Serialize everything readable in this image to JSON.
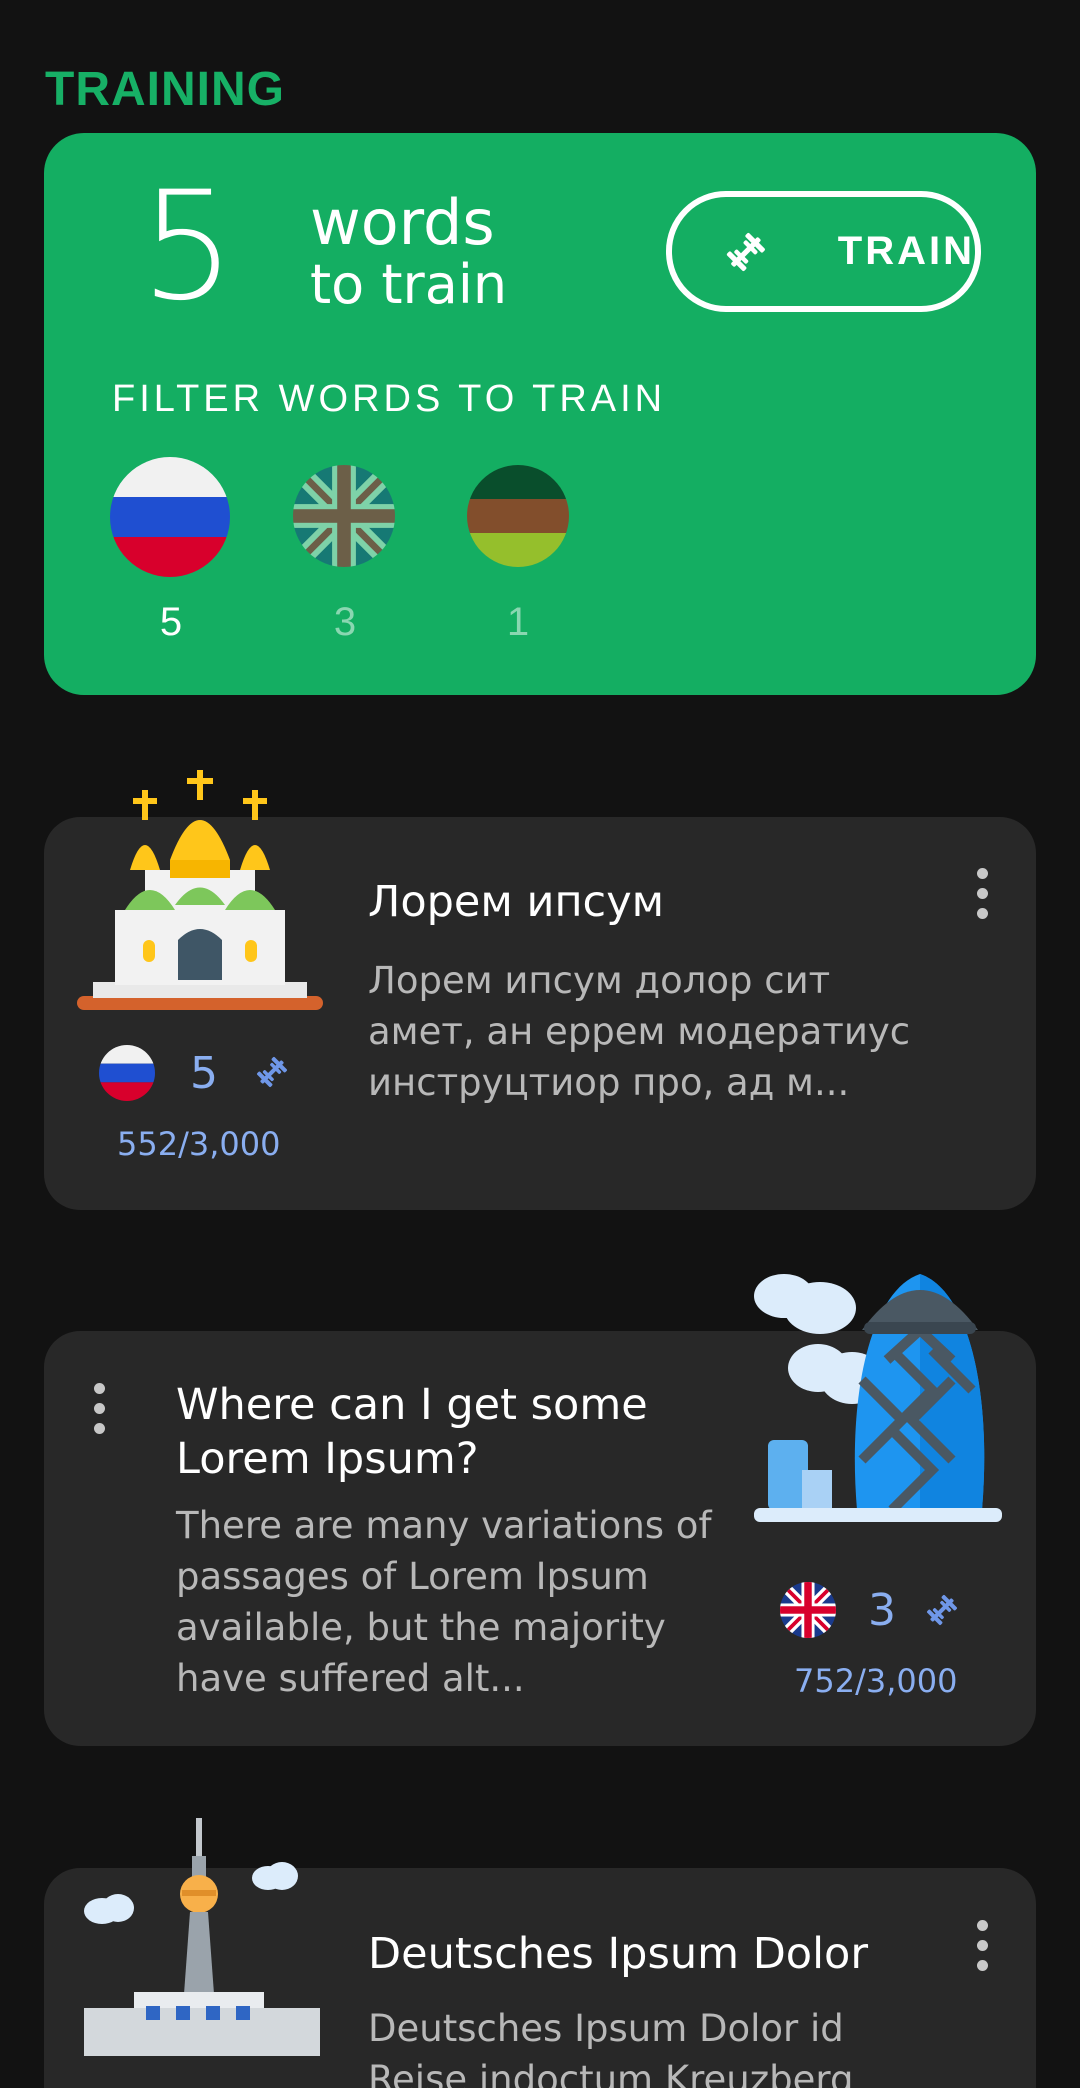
{
  "section": {
    "title": "TRAINING"
  },
  "training_card": {
    "count": "5",
    "words_label": "words",
    "to_train_label": "to train",
    "train_button": "TRAIN",
    "filter_label": "FILTER WORDS TO TRAIN",
    "filters": [
      {
        "flag": "russia-flag",
        "count": "5",
        "selected": true
      },
      {
        "flag": "uk-flag",
        "count": "3",
        "selected": false
      },
      {
        "flag": "germany-flag",
        "count": "1",
        "selected": false
      }
    ]
  },
  "lessons": [
    {
      "illustration": "church-illustration",
      "title": "Лорем ипсум",
      "description": "Лорем ипсум долор сит амет, ан еррем модератиус инструцтиор про, ад м...",
      "flag": "russia-flag",
      "words_to_train": "5",
      "progress": "552/3,000"
    },
    {
      "illustration": "gherkin-tower-illustration",
      "title": "Where can I get some Lorem Ipsum?",
      "description": "There are many variations of passages of Lorem Ipsum available, but the majority have suffered alt...",
      "flag": "uk-flag",
      "words_to_train": "3",
      "progress": "752/3,000"
    },
    {
      "illustration": "tv-tower-illustration",
      "title": "Deutsches Ipsum Dolor",
      "description": "Deutsches Ipsum Dolor id Reise indoctum Kreuzberg"
    }
  ],
  "colors": {
    "background": "#121212",
    "accent_green": "#14ae62",
    "card": "#282828",
    "stat_blue": "#8aaef0"
  }
}
